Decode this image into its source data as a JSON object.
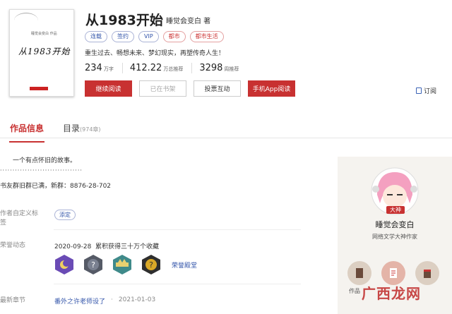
{
  "book": {
    "title": "从1983开始",
    "author": "睡觉会变白 著",
    "cover_text": "从1983开始",
    "cover_small": "睡觉会变白 作品",
    "tags": [
      {
        "label": "连载",
        "red": false
      },
      {
        "label": "签约",
        "red": false
      },
      {
        "label": "VIP",
        "red": false
      },
      {
        "label": "都市",
        "red": true
      },
      {
        "label": "都市生活",
        "red": true
      }
    ],
    "intro": "重生过去、畅想未来、梦幻现实，再塑传奇人生！",
    "stats": [
      {
        "num": "234",
        "unit": "万字"
      },
      {
        "num": "412.22",
        "unit": "万总推荐"
      },
      {
        "num": "3298",
        "unit": "周推荐"
      }
    ],
    "buttons": {
      "read": "继续阅读",
      "shelf": "已在书架",
      "vote": "投票互动",
      "app": "手机App阅读"
    },
    "subscribe": "订阅"
  },
  "tabs": {
    "info": "作品信息",
    "catalog": "目录",
    "catalog_count": "(974章)"
  },
  "desc": {
    "line1": "一个有点怀旧的故事。",
    "dots": "·································",
    "line2": "书友群旧群已满，新群：8876-28-702"
  },
  "tags_section": {
    "label": "作者自定义标签",
    "tag": "添定"
  },
  "honor": {
    "label": "荣誉动态",
    "date": "2020-09-28",
    "text": "累积获得三十万个收藏",
    "hall": "荣誉殿堂"
  },
  "latest": {
    "label": "最新章节",
    "link": "番外之许老师设了",
    "sep": "·",
    "date": "2021-01-03"
  },
  "author_panel": {
    "rank": "大神",
    "name": "睡觉会变白",
    "role": "网络文学大神作家",
    "works_label": "作品"
  },
  "watermark": "广西龙网",
  "colors": {
    "accent": "#c83131",
    "link": "#3355aa",
    "panel": "#f5f3ef"
  },
  "badge_icons": [
    "moon-badge-icon",
    "question-badge-icon",
    "crown-badge-icon",
    "question-gold-badge-icon"
  ]
}
